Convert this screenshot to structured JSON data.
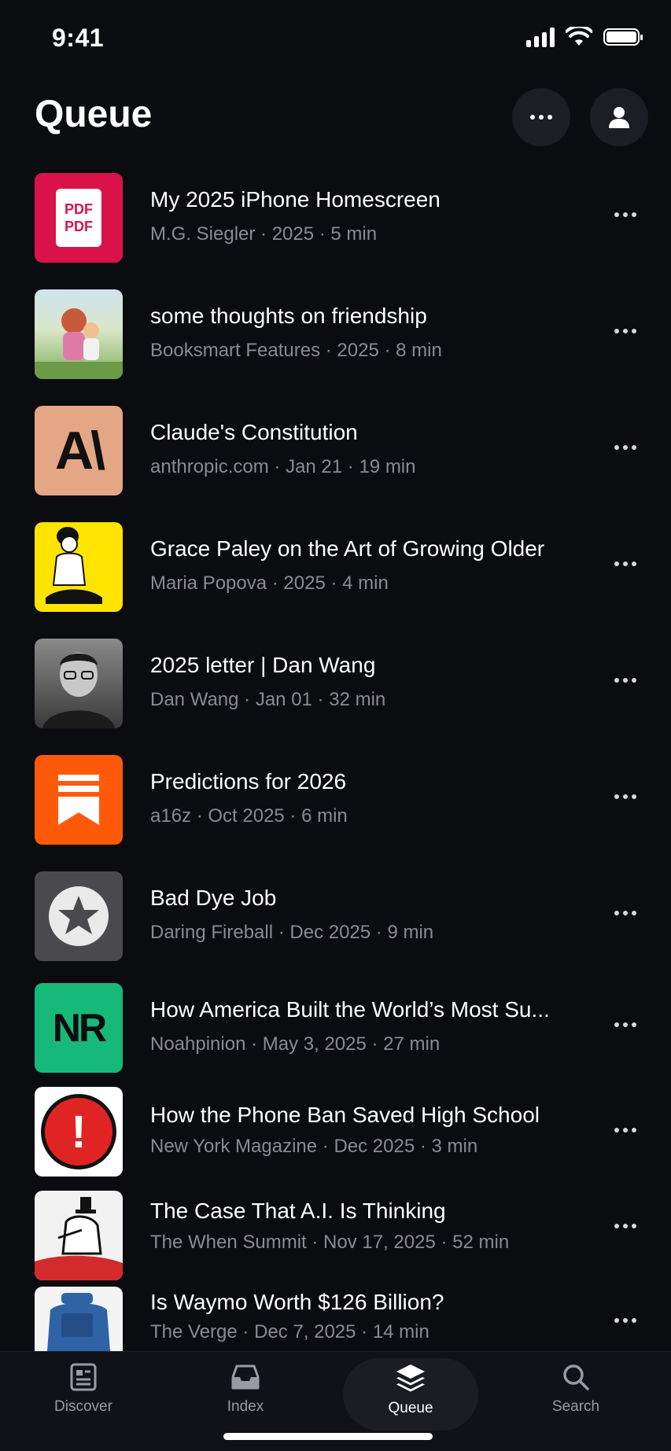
{
  "status_bar": {
    "time": "9:41"
  },
  "header": {
    "title": "Queue"
  },
  "items": [
    {
      "title": "My 2025 iPhone Homescreen",
      "meta": "M.G. Siegler · 2025 · 5 min",
      "thumb_text": "PDF",
      "thumb_color": "#d9134a"
    },
    {
      "title": "some thoughts on friendship",
      "meta": "Booksmart Features · 2025 · 8 min",
      "thumb_color": "#b8cfa8"
    },
    {
      "title": "Claude's Constitution",
      "meta": "anthropic.com · Jan 21 · 19 min",
      "thumb_text": "A\\",
      "thumb_color": "#e4a684"
    },
    {
      "title": "Grace Paley on the Art of Growing Older",
      "meta": "Maria Popova · 2025 · 4 min",
      "thumb_color": "#ffe400"
    },
    {
      "title": "2025 letter | Dan Wang",
      "meta": "Dan Wang · Jan 01 · 32 min",
      "thumb_color": "#555555"
    },
    {
      "title": "Predictions for 2026",
      "meta": "a16z · Oct 2025 · 6 min",
      "thumb_color": "#ff5a0a"
    },
    {
      "title": "Bad Dye Job",
      "meta": "Daring Fireball · Dec 2025 · 9 min",
      "thumb_color": "#4a4a4e"
    },
    {
      "title": "How America Built the World’s Most Su...",
      "meta": "Noahpinion · May 3, 2025 · 27 min",
      "thumb_text": "NR",
      "thumb_color": "#17b978"
    },
    {
      "title": "How the Phone Ban Saved High School",
      "meta": "New York Magazine · Dec 2025 · 3 min",
      "thumb_text": "!",
      "thumb_color": "#e02424"
    },
    {
      "title": "The Case That A.I. Is Thinking",
      "meta": "The When Summit · Nov 17, 2025 · 52 min",
      "thumb_color": "#f2f2f2"
    },
    {
      "title": "Is Waymo Worth $126 Billion?",
      "meta": "The Verge · Dec 7, 2025 · 14 min",
      "thumb_color": "#2e63a6"
    }
  ],
  "tabs": [
    {
      "label": "Discover",
      "icon": "newspaper-icon"
    },
    {
      "label": "Index",
      "icon": "inbox-icon"
    },
    {
      "label": "Queue",
      "icon": "stack-icon",
      "active": true
    },
    {
      "label": "Search",
      "icon": "search-icon"
    }
  ]
}
